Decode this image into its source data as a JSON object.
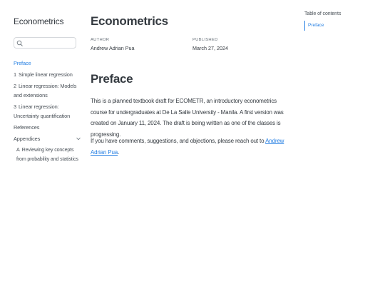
{
  "sidebar": {
    "title": "Econometrics",
    "search": {
      "placeholder": "",
      "value": ""
    },
    "items": [
      {
        "num": "",
        "label": "Preface",
        "active": true
      },
      {
        "num": "1",
        "label": "Simple linear regression"
      },
      {
        "num": "2",
        "label": "Linear regression: Models and extensions"
      },
      {
        "num": "3",
        "label": "Linear regression: Uncertainty quantification"
      },
      {
        "num": "",
        "label": "References"
      }
    ],
    "appendices": {
      "label": "Appendices",
      "items": [
        {
          "num": "A",
          "label": "Reviewing key concepts from probability and statistics"
        }
      ]
    }
  },
  "main": {
    "title": "Econometrics",
    "author_label": "AUTHOR",
    "author_value": "Andrew Adrian Pua",
    "published_label": "PUBLISHED",
    "published_value": "March 27, 2024",
    "section_title": "Preface",
    "para1": "This is a planned textbook draft for ECOMETR, an introductory econometrics course for undergraduates at De La Salle University - Manila. A first version was created on January 11, 2024. The draft is being written as one of the classes is progressing.",
    "para2_before": "If you have comments, suggestions, and objections, please reach out to ",
    "para2_link": "Andrew Adrian Pua",
    "para2_after": "."
  },
  "toc": {
    "title": "Table of contents",
    "items": [
      "Preface"
    ]
  },
  "colors": {
    "accent": "#2780e3",
    "text": "#343a40",
    "muted": "#6c757d"
  }
}
